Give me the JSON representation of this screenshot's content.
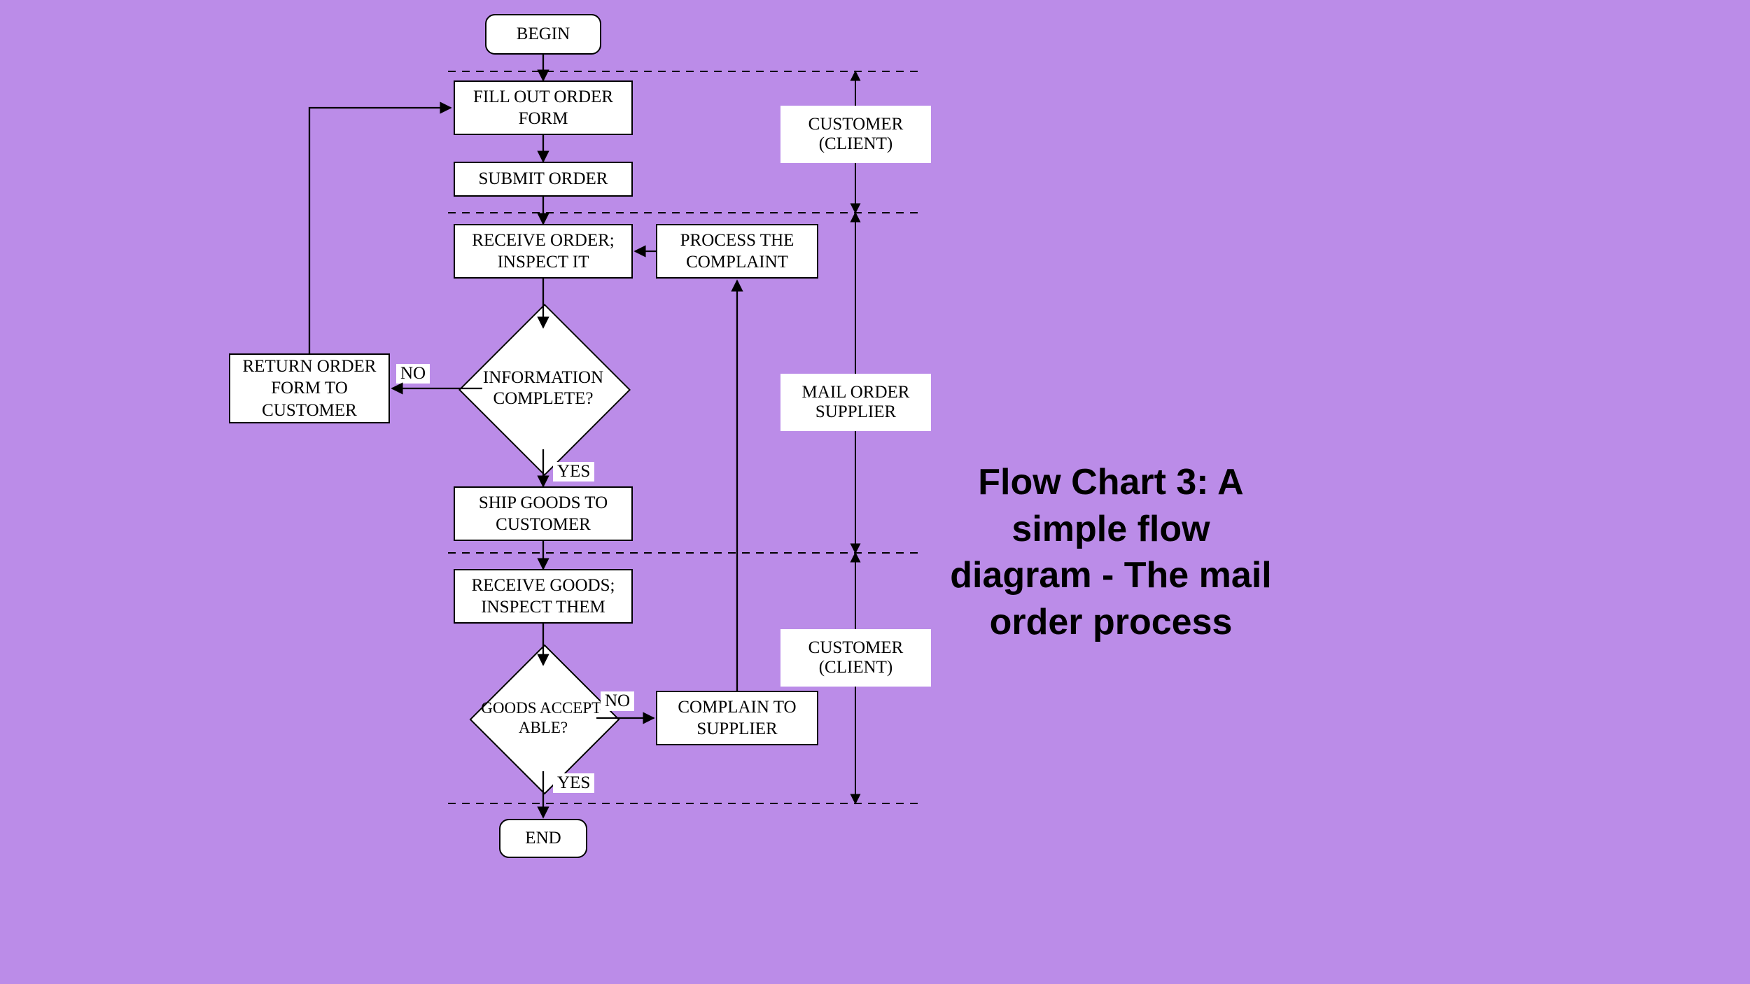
{
  "caption": "Flow Chart 3:  A simple flow diagram - The mail order process",
  "nodes": {
    "begin": "BEGIN",
    "fillOut": "FILL OUT ORDER FORM",
    "submit": "SUBMIT ORDER",
    "receiveOrder": "RECEIVE ORDER; INSPECT IT",
    "processComplaint": "PROCESS THE COMPLAINT",
    "infoComplete": "INFORMATION COMPLETE?",
    "returnForm": "RETURN ORDER FORM TO CUSTOMER",
    "shipGoods": "SHIP GOODS TO CUSTOMER",
    "receiveGoods": "RECEIVE GOODS; INSPECT THEM",
    "goodsAcceptable": "GOODS ACCEPT-ABLE?",
    "complain": "COMPLAIN TO SUPPLIER",
    "end": "END"
  },
  "lanes": {
    "customerTop": "CUSTOMER (CLIENT)",
    "supplier": "MAIL ORDER SUPPLIER",
    "customerBottom": "CUSTOMER (CLIENT)"
  },
  "labels": {
    "no": "NO",
    "yes": "YES"
  }
}
